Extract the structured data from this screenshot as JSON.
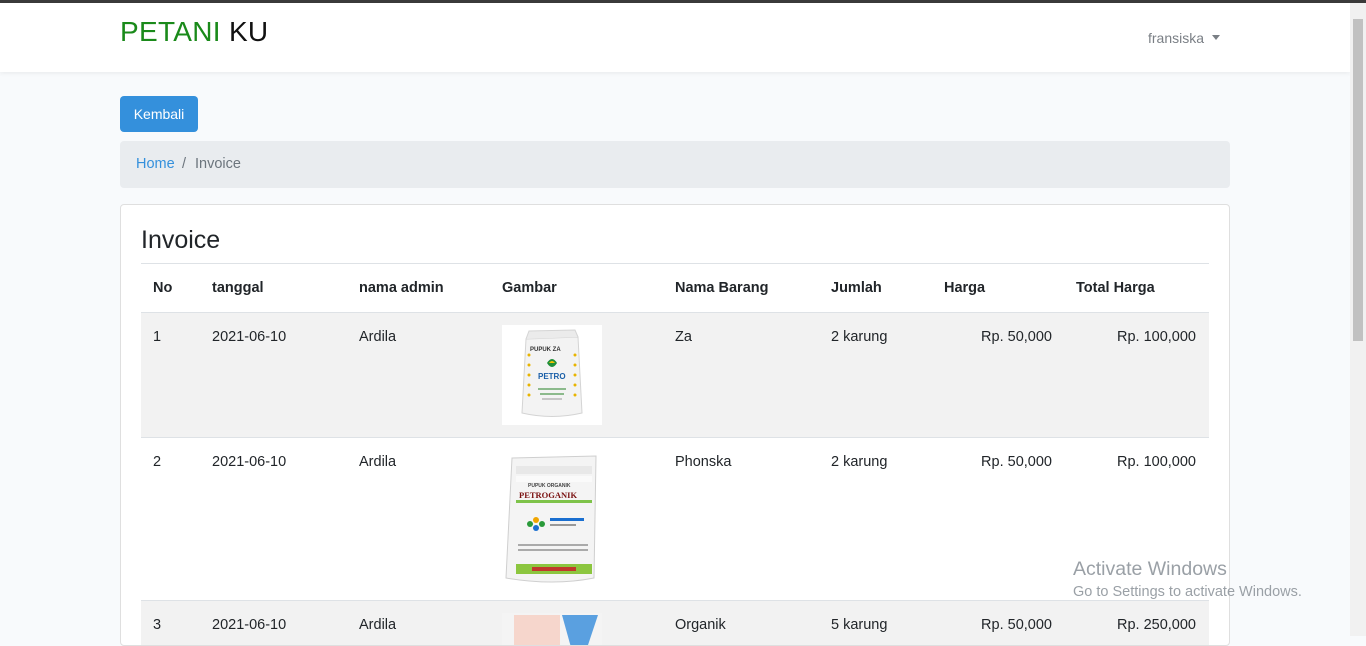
{
  "navbar": {
    "brand_part1": "PETANI",
    "brand_part2": "KU",
    "user_name": "fransiska"
  },
  "actions": {
    "back_label": "Kembali"
  },
  "breadcrumb": {
    "home": "Home",
    "separator": "/",
    "current": "Invoice"
  },
  "invoice": {
    "title": "Invoice",
    "columns": [
      "No",
      "tanggal",
      "nama admin",
      "Gambar",
      "Nama Barang",
      "Jumlah",
      "Harga",
      "Total Harga"
    ],
    "rows": [
      {
        "no": "1",
        "tanggal": "2021-06-10",
        "admin": "Ardila",
        "image_label": "PUPUK ZA",
        "image_brand": "PETRO",
        "barang": "Za",
        "jumlah": "2 karung",
        "harga": "Rp. 50,000",
        "total": "Rp. 100,000"
      },
      {
        "no": "2",
        "tanggal": "2021-06-10",
        "admin": "Ardila",
        "image_label": "PUPUK ORGANIK",
        "image_brand": "PETROGANIK",
        "barang": "Phonska",
        "jumlah": "2 karung",
        "harga": "Rp. 50,000",
        "total": "Rp. 100,000"
      },
      {
        "no": "3",
        "tanggal": "2021-06-10",
        "admin": "Ardila",
        "barang": "Organik",
        "jumlah": "5 karung",
        "harga": "Rp. 50,000",
        "total": "Rp. 250,000"
      }
    ]
  },
  "watermark": {
    "line1": "Activate Windows",
    "line2": "Go to Settings to activate Windows."
  },
  "colors": {
    "primary": "#3490dc",
    "brand_green": "#1a8a1a",
    "stripe": "#f2f2f2"
  }
}
